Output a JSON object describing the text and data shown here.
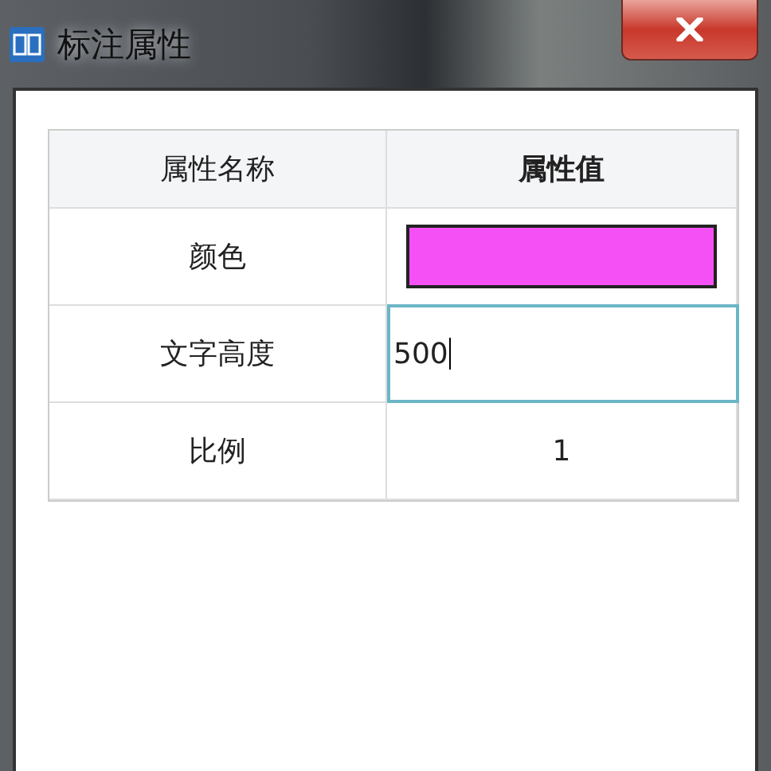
{
  "window": {
    "title": "标注属性"
  },
  "table": {
    "columns": [
      "属性名称",
      "属性值"
    ],
    "rows": [
      {
        "name": "颜色",
        "kind": "color",
        "color": "#f550f5"
      },
      {
        "name": "文字高度",
        "kind": "input",
        "value": "500",
        "focused": true
      },
      {
        "name": "比例",
        "kind": "text",
        "value": "1"
      }
    ]
  }
}
